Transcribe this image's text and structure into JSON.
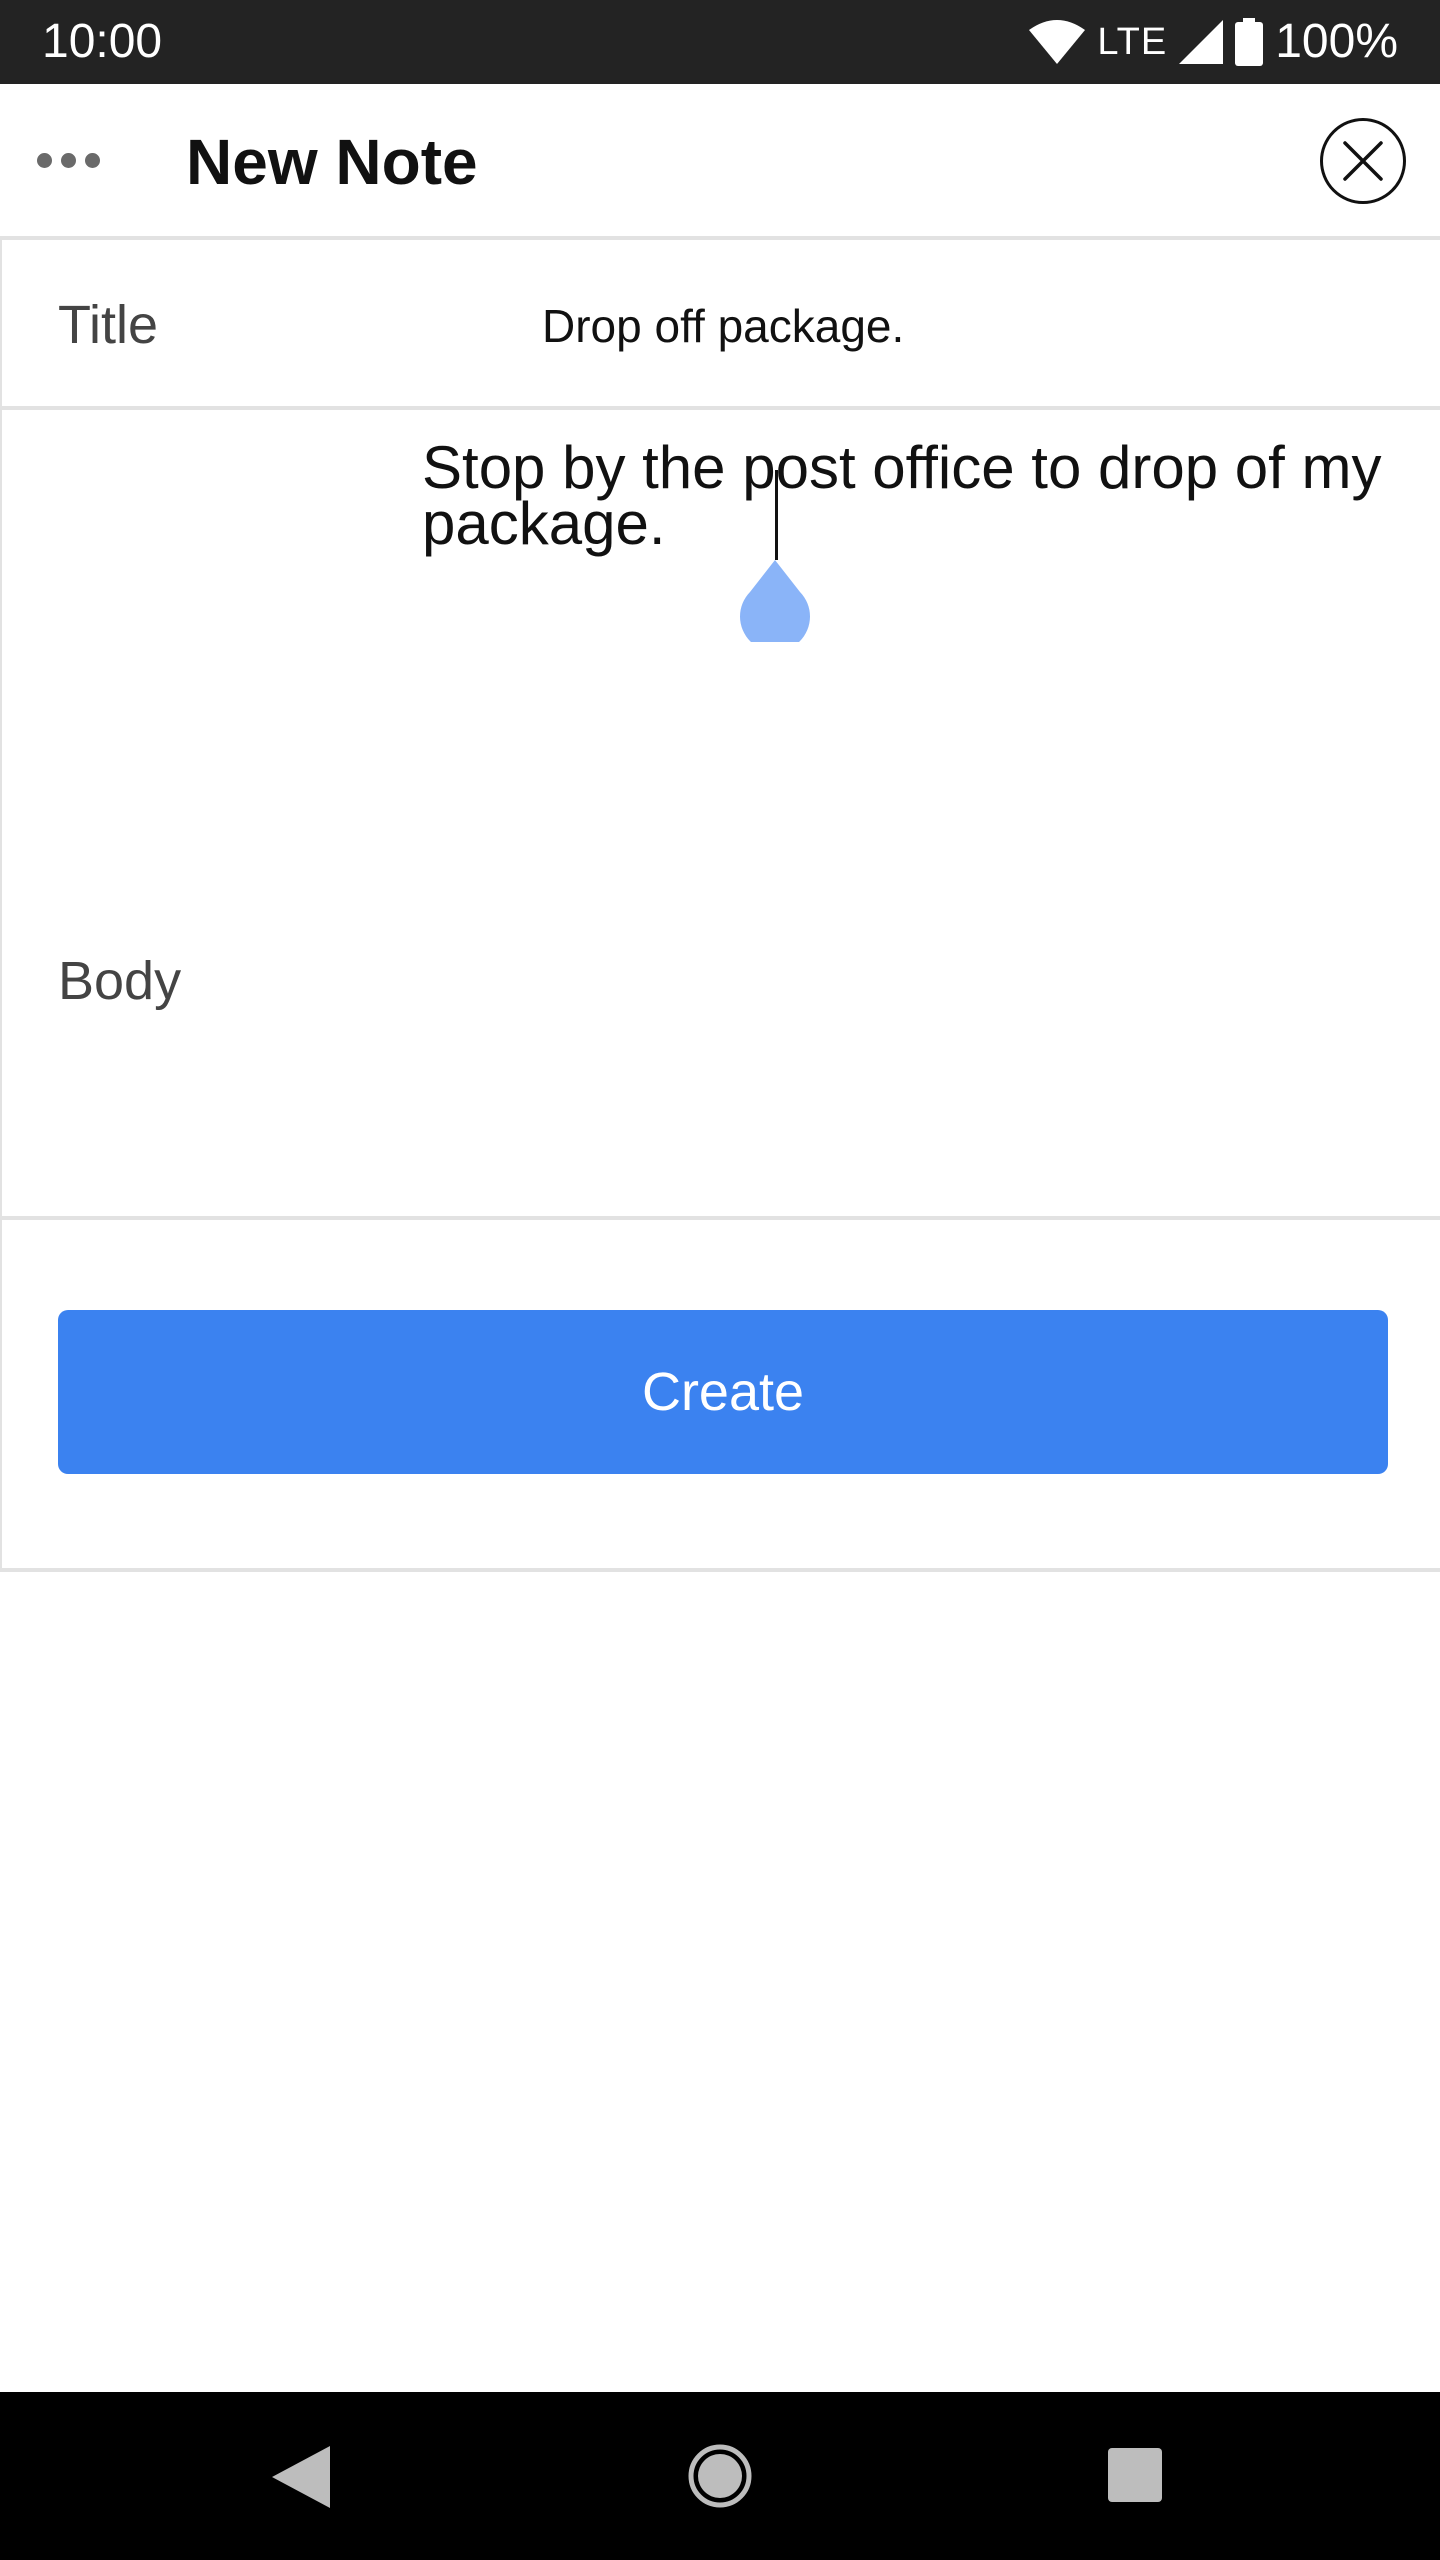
{
  "status_bar": {
    "time": "10:00",
    "network": "LTE",
    "battery": "100%",
    "icons": [
      "wifi-icon",
      "signal-icon",
      "battery-icon"
    ]
  },
  "header": {
    "title": "New Note",
    "menu_icon": "more-horizontal-icon",
    "close_icon": "close-icon"
  },
  "form": {
    "title_label": "Title",
    "title_value": "Drop off package.",
    "body_label": "Body",
    "body_value": "Stop by the post office to drop of my package."
  },
  "actions": {
    "create_label": "Create"
  },
  "colors": {
    "status_bar": "#232323",
    "primary_button": "#3b82f0",
    "cursor_handle": "#8ab4f8",
    "divider": "#e2e2e2"
  },
  "nav_bar": {
    "icons": [
      "back-icon",
      "home-icon",
      "recents-icon"
    ]
  }
}
